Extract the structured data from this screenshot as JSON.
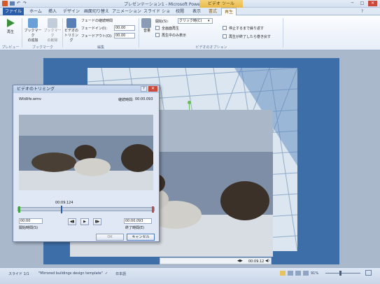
{
  "window": {
    "title": "プレゼンテーション1 - Microsoft PowerPoint",
    "context_tab_title": "ビデオ ツール",
    "minimize": "─",
    "maximize": "□",
    "close": "✕"
  },
  "tabs": [
    "ファイル",
    "ホーム",
    "挿入",
    "デザイン",
    "画面切り替え",
    "アニメーション",
    "スライド ショー",
    "校閲",
    "表示",
    "書式",
    "再生"
  ],
  "ribbon": {
    "preview": {
      "play": "再生",
      "group": "プレビュー"
    },
    "bookmarks": {
      "add": "ブックマーク\nの追加",
      "remove": "ブックマーク\nの削除",
      "group": "ブックマーク"
    },
    "editing": {
      "trim": "ビデオの\nトリミング",
      "fade_title": "フェードの継続時間",
      "fade_in_label": "フェードイン(I):",
      "fade_in_value": "00.00",
      "fade_out_label": "フェードアウト(O):",
      "fade_out_value": "00.00",
      "group": "編集"
    },
    "video_options": {
      "volume": "音量",
      "start_label": "開始(S):",
      "start_value": "クリック時(C)",
      "fullscreen": "全画面再生",
      "hide_when_not_playing": "再生中のみ表示",
      "loop": "停止するまで繰り返す",
      "rewind": "再生が終了したら巻き戻す",
      "group": "ビデオのオプション"
    }
  },
  "slide": {
    "video_time": "00:09.12"
  },
  "dialog": {
    "title": "ビデオのトリミング",
    "help": "?",
    "close": "✕",
    "filename": "Wildlife.wmv",
    "duration_label": "継続時間:",
    "duration_value": "00:00.093",
    "playhead_time": "00:09.124",
    "start_value": "00:00",
    "start_label": "開始時間(S)",
    "end_value": "00:00.093",
    "end_label": "終了時間(E)",
    "ok": "OK",
    "cancel": "キャンセル",
    "playhead_position": 0.32,
    "end_position": 1.0
  },
  "statusbar": {
    "slide": "スライド 1/1",
    "theme": "\"Mirrored buildings design template\"",
    "language": "日本語",
    "zoom": "91%"
  },
  "colors": {
    "accent": "#2a5ea8",
    "slide_background": "#3e6ea8",
    "close_red": "#c94a3a"
  }
}
